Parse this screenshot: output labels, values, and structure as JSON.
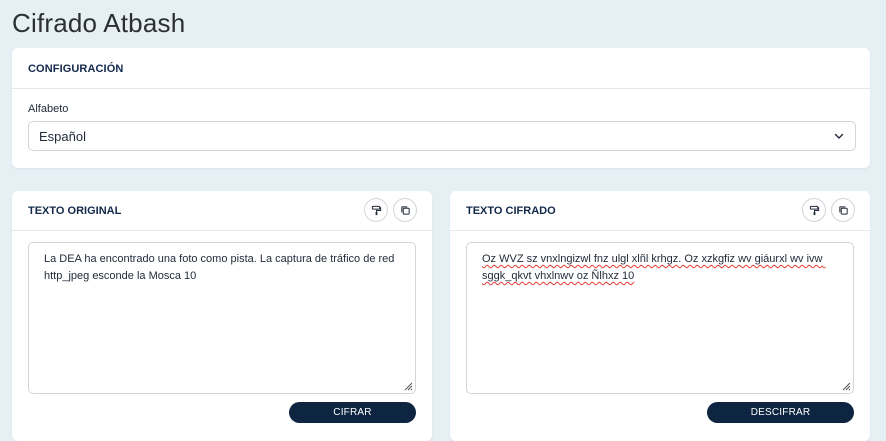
{
  "page": {
    "title": "Cifrado Atbash"
  },
  "config": {
    "header": "CONFIGURACIÓN",
    "alphabet_label": "Alfabeto",
    "alphabet_selected": "Español"
  },
  "original": {
    "header": "TEXTO ORIGINAL",
    "text": "La DEA ha encontrado una foto como pista. La captura de tráfico de red http_jpeg esconde la Mosca 10",
    "action_label": "CIFRAR",
    "clear_icon": "paint-roller-icon",
    "copy_icon": "copy-icon"
  },
  "cipher": {
    "header": "TEXTO CIFRADO",
    "text": "Oz WVZ sz vnxlngizwl fnz ulgl xlñl krhgz. Oz xzkgfiz wv giáurxl wv ivw sggk_qkvt vhxlnwv oz Ñlhxz 10",
    "action_label": "DESCIFRAR",
    "clear_icon": "paint-roller-icon",
    "copy_icon": "copy-icon"
  },
  "colors": {
    "background": "#e6f0f4",
    "card": "#ffffff",
    "primary_button": "#0d2540",
    "heading": "#13294b",
    "spellcheck_underline": "#e53935"
  }
}
